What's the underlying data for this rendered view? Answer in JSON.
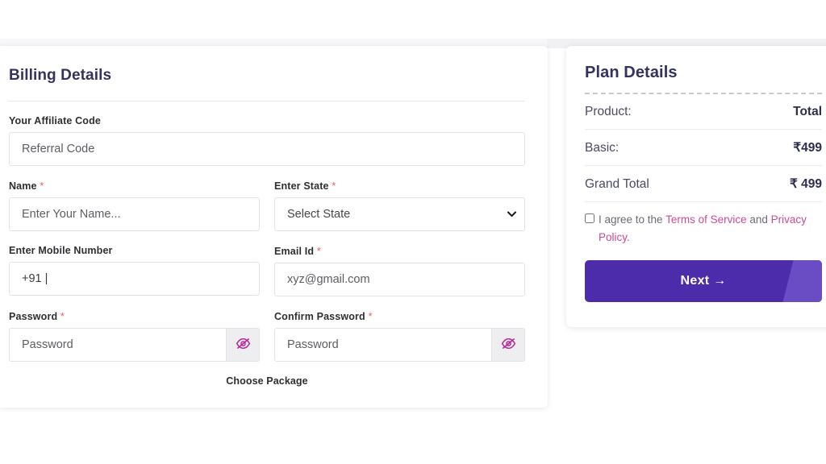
{
  "billing": {
    "title": "Billing Details",
    "affiliate": {
      "label": "Your Affiliate Code",
      "placeholder": "Referral Code",
      "value": ""
    },
    "name": {
      "label": "Name",
      "required_mark": "*",
      "placeholder": "Enter Your Name...",
      "value": ""
    },
    "state": {
      "label": "Enter State",
      "required_mark": "*",
      "selected": "Select State",
      "options": [
        "Select State"
      ]
    },
    "mobile": {
      "label": "Enter Mobile Number",
      "value": "+91 |",
      "placeholder": "+91 |"
    },
    "email": {
      "label": "Email Id",
      "required_mark": "*",
      "placeholder": "xyz@gmail.com",
      "value": ""
    },
    "password": {
      "label": "Password",
      "required_mark": "*",
      "placeholder": "Password",
      "value": "",
      "toggle_icon": "eye-slash-icon"
    },
    "confirm_password": {
      "label": "Confirm Password",
      "required_mark": "*",
      "placeholder": "Password",
      "value": "",
      "toggle_icon": "eye-slash-icon"
    },
    "choose_package": "Choose Package"
  },
  "plan": {
    "title": "Plan Details",
    "rows": [
      {
        "key": "Product:",
        "value": "Total"
      },
      {
        "key": "Basic:",
        "value": "₹499"
      },
      {
        "key": "Grand Total",
        "value": "₹ 499"
      }
    ],
    "terms": {
      "prefix": "I agree to the ",
      "link1": "Terms of Service",
      "middle": " and ",
      "link2": "Privacy Policy",
      "suffix": ".",
      "checked": false
    },
    "next_button": {
      "label": "Next",
      "arrow": "→"
    }
  },
  "colors": {
    "heading": "#33335b",
    "primary": "#4c2cab",
    "primary_accent": "#6a4cc4",
    "link": "#cc4b92",
    "required": "#ef5b5b",
    "eye_icon": "#b5299a",
    "border": "#e3e3e6"
  }
}
